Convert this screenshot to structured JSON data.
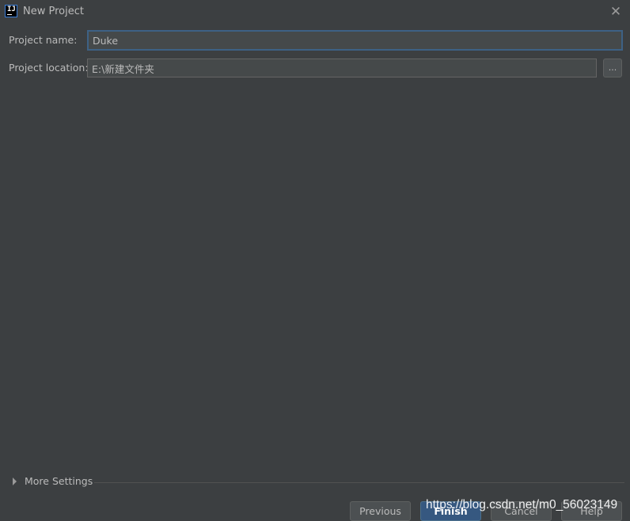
{
  "window": {
    "title": "New Project",
    "logo_text": "IJ",
    "close_glyph": "✕"
  },
  "form": {
    "project_name_label": "Project name:",
    "project_name_value": "Duke",
    "project_location_label": "Project location:",
    "project_location_value": "E:\\新建文件夹",
    "browse_label": "..."
  },
  "more_settings": {
    "label": "More Settings",
    "expanded": false
  },
  "buttons": {
    "previous": "Previous",
    "finish": "Finish",
    "cancel": "Cancel",
    "help": "Help"
  },
  "watermark": {
    "text": "https://blog.csdn.net/m0_56023149"
  },
  "colors": {
    "background": "#3c3f41",
    "input_bg": "#45494a",
    "focus_border": "#3d6185",
    "primary_button": "#365880",
    "text": "#bbbbbb"
  },
  "icons": {
    "logo": "intellij-logo-icon",
    "close": "close-icon",
    "expand": "triangle-right-icon"
  }
}
